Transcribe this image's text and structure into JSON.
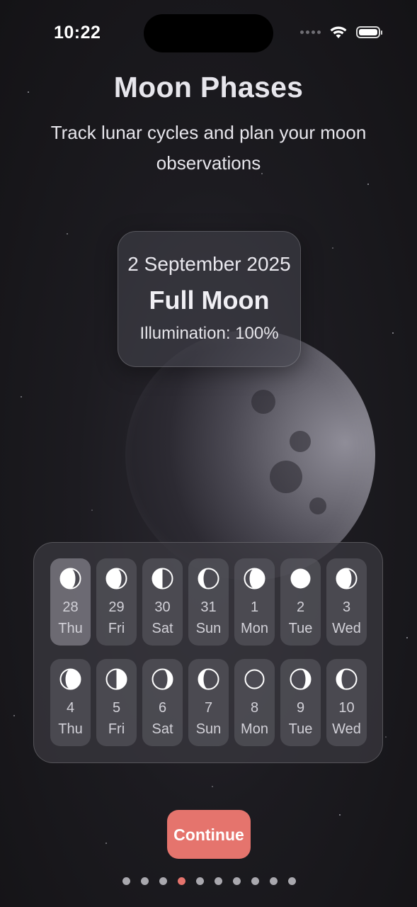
{
  "status_bar": {
    "time": "10:22"
  },
  "header": {
    "title": "Moon Phases",
    "subtitle": "Track lunar cycles and plan your moon observations"
  },
  "selected_day": {
    "date": "2 September 2025",
    "phase": "Full Moon",
    "illumination": "Illumination: 100%"
  },
  "calendar": {
    "days": [
      {
        "num": "28",
        "dow": "Thu",
        "phase": "waning-gibbous",
        "selected": true
      },
      {
        "num": "29",
        "dow": "Fri",
        "phase": "waning-gibbous",
        "selected": false
      },
      {
        "num": "30",
        "dow": "Sat",
        "phase": "last-quarter",
        "selected": false
      },
      {
        "num": "31",
        "dow": "Sun",
        "phase": "waning-crescent",
        "selected": false
      },
      {
        "num": "1",
        "dow": "Mon",
        "phase": "waxing-gibbous",
        "selected": false
      },
      {
        "num": "2",
        "dow": "Tue",
        "phase": "full-moon",
        "selected": false
      },
      {
        "num": "3",
        "dow": "Wed",
        "phase": "waning-gibbous",
        "selected": false
      },
      {
        "num": "4",
        "dow": "Thu",
        "phase": "waxing-gibbous",
        "selected": false
      },
      {
        "num": "5",
        "dow": "Fri",
        "phase": "first-quarter",
        "selected": false
      },
      {
        "num": "6",
        "dow": "Sat",
        "phase": "waxing-crescent",
        "selected": false
      },
      {
        "num": "7",
        "dow": "Sun",
        "phase": "waning-crescent",
        "selected": false
      },
      {
        "num": "8",
        "dow": "Mon",
        "phase": "new-moon",
        "selected": false
      },
      {
        "num": "9",
        "dow": "Tue",
        "phase": "waxing-crescent",
        "selected": false
      },
      {
        "num": "10",
        "dow": "Wed",
        "phase": "waning-crescent",
        "selected": false
      }
    ]
  },
  "footer": {
    "continue_label": "Continue",
    "page_count": 10,
    "active_page": 4
  },
  "colors": {
    "accent": "#e5746d",
    "background": "#1c1b20"
  }
}
